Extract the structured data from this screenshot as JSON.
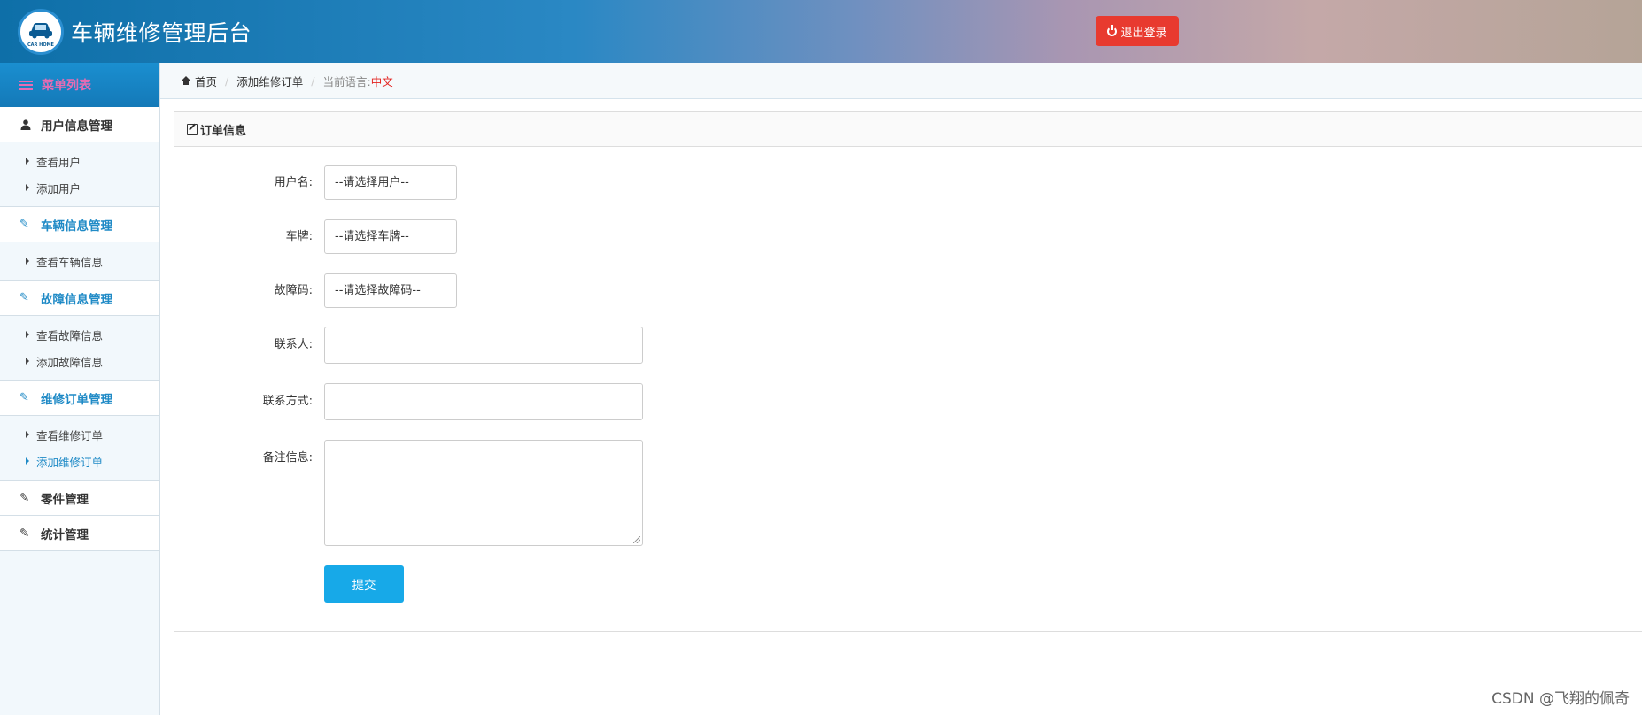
{
  "header": {
    "logo_text": "CAR HOME",
    "title": "车辆维修管理后台",
    "logout_label": "退出登录",
    "logout_color": "#e83a2f"
  },
  "sidebar": {
    "menu_title": "菜单列表",
    "groups": [
      {
        "title": "用户信息管理",
        "icon": "user-icon",
        "items": [
          "查看用户",
          "添加用户"
        ]
      },
      {
        "title": "车辆信息管理",
        "icon": "edit-icon",
        "items": [
          "查看车辆信息"
        ]
      },
      {
        "title": "故障信息管理",
        "icon": "edit-icon",
        "items": [
          "查看故障信息",
          "添加故障信息"
        ]
      },
      {
        "title": "维修订单管理",
        "icon": "edit-icon",
        "items": [
          "查看维修订单",
          "添加维修订单"
        ],
        "active_item": "添加维修订单"
      }
    ],
    "simple_items": [
      "零件管理",
      "统计管理"
    ]
  },
  "breadcrumb": {
    "home": "首页",
    "current": "添加维修订单",
    "lang_label": "当前语言:",
    "lang_value": "中文"
  },
  "form": {
    "panel_title": "订单信息",
    "fields": {
      "username": {
        "label": "用户名:",
        "value": "--请选择用户--"
      },
      "plate": {
        "label": "车牌:",
        "value": "--请选择车牌--"
      },
      "fault_code": {
        "label": "故障码:",
        "value": "--请选择故障码--"
      },
      "contact": {
        "label": "联系人:",
        "value": ""
      },
      "phone": {
        "label": "联系方式:",
        "value": ""
      },
      "remark": {
        "label": "备注信息:",
        "value": ""
      }
    },
    "submit_label": "提交"
  },
  "watermark": "CSDN @飞翔的佩奇"
}
